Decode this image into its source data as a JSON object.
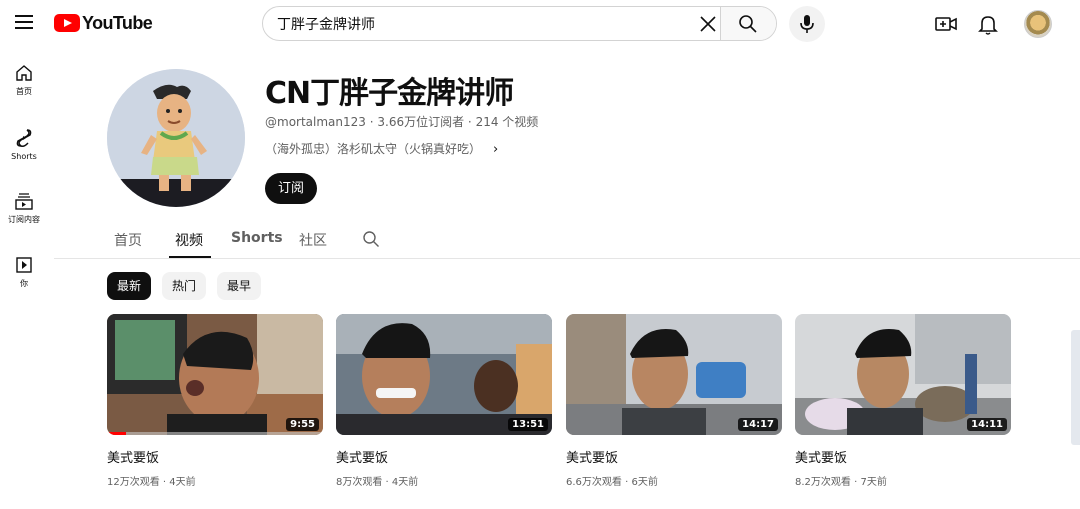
{
  "topbar": {
    "logo_text": "YouTube",
    "search_value": "丁胖子金牌讲师",
    "icons": [
      "menu-icon",
      "search-icon",
      "close-icon",
      "mic-icon",
      "create-video-icon",
      "bell-icon"
    ]
  },
  "leftnav": {
    "items": [
      {
        "label": "首页",
        "icon": "home-icon"
      },
      {
        "label": "Shorts",
        "icon": "shorts-icon"
      },
      {
        "label": "订阅内容",
        "icon": "subscriptions-icon"
      },
      {
        "label": "你",
        "icon": "you-icon"
      }
    ]
  },
  "channel": {
    "name": "CN丁胖子金牌讲师",
    "handle": "@mortalman123",
    "subscribers": "3.66万位订阅者",
    "video_count": "214 个视频",
    "description": "（海外孤忠）洛杉矶太守（火锅真好吃）",
    "subscribe_label": "订阅"
  },
  "tabs": [
    "首页",
    "视频",
    "Shorts",
    "社区"
  ],
  "active_tab": "视频",
  "chips": [
    "最新",
    "热门",
    "最早"
  ],
  "active_chip": "最新",
  "videos": [
    {
      "title": "美式要饭",
      "views": "12万次观看",
      "age": "4天前",
      "duration": "9:55",
      "watched_fraction": 0.09
    },
    {
      "title": "美式要饭",
      "views": "8万次观看",
      "age": "4天前",
      "duration": "13:51"
    },
    {
      "title": "美式要饭",
      "views": "6.6万次观看",
      "age": "6天前",
      "duration": "14:17"
    },
    {
      "title": "美式要饭",
      "views": "8.2万次观看",
      "age": "7天前",
      "duration": "14:11"
    }
  ],
  "meta_separator": " · ",
  "colors": {
    "brand_red": "#ff0000",
    "text_primary": "#0f0f0f",
    "text_secondary": "#606060",
    "chip_bg": "#f2f2f2"
  }
}
